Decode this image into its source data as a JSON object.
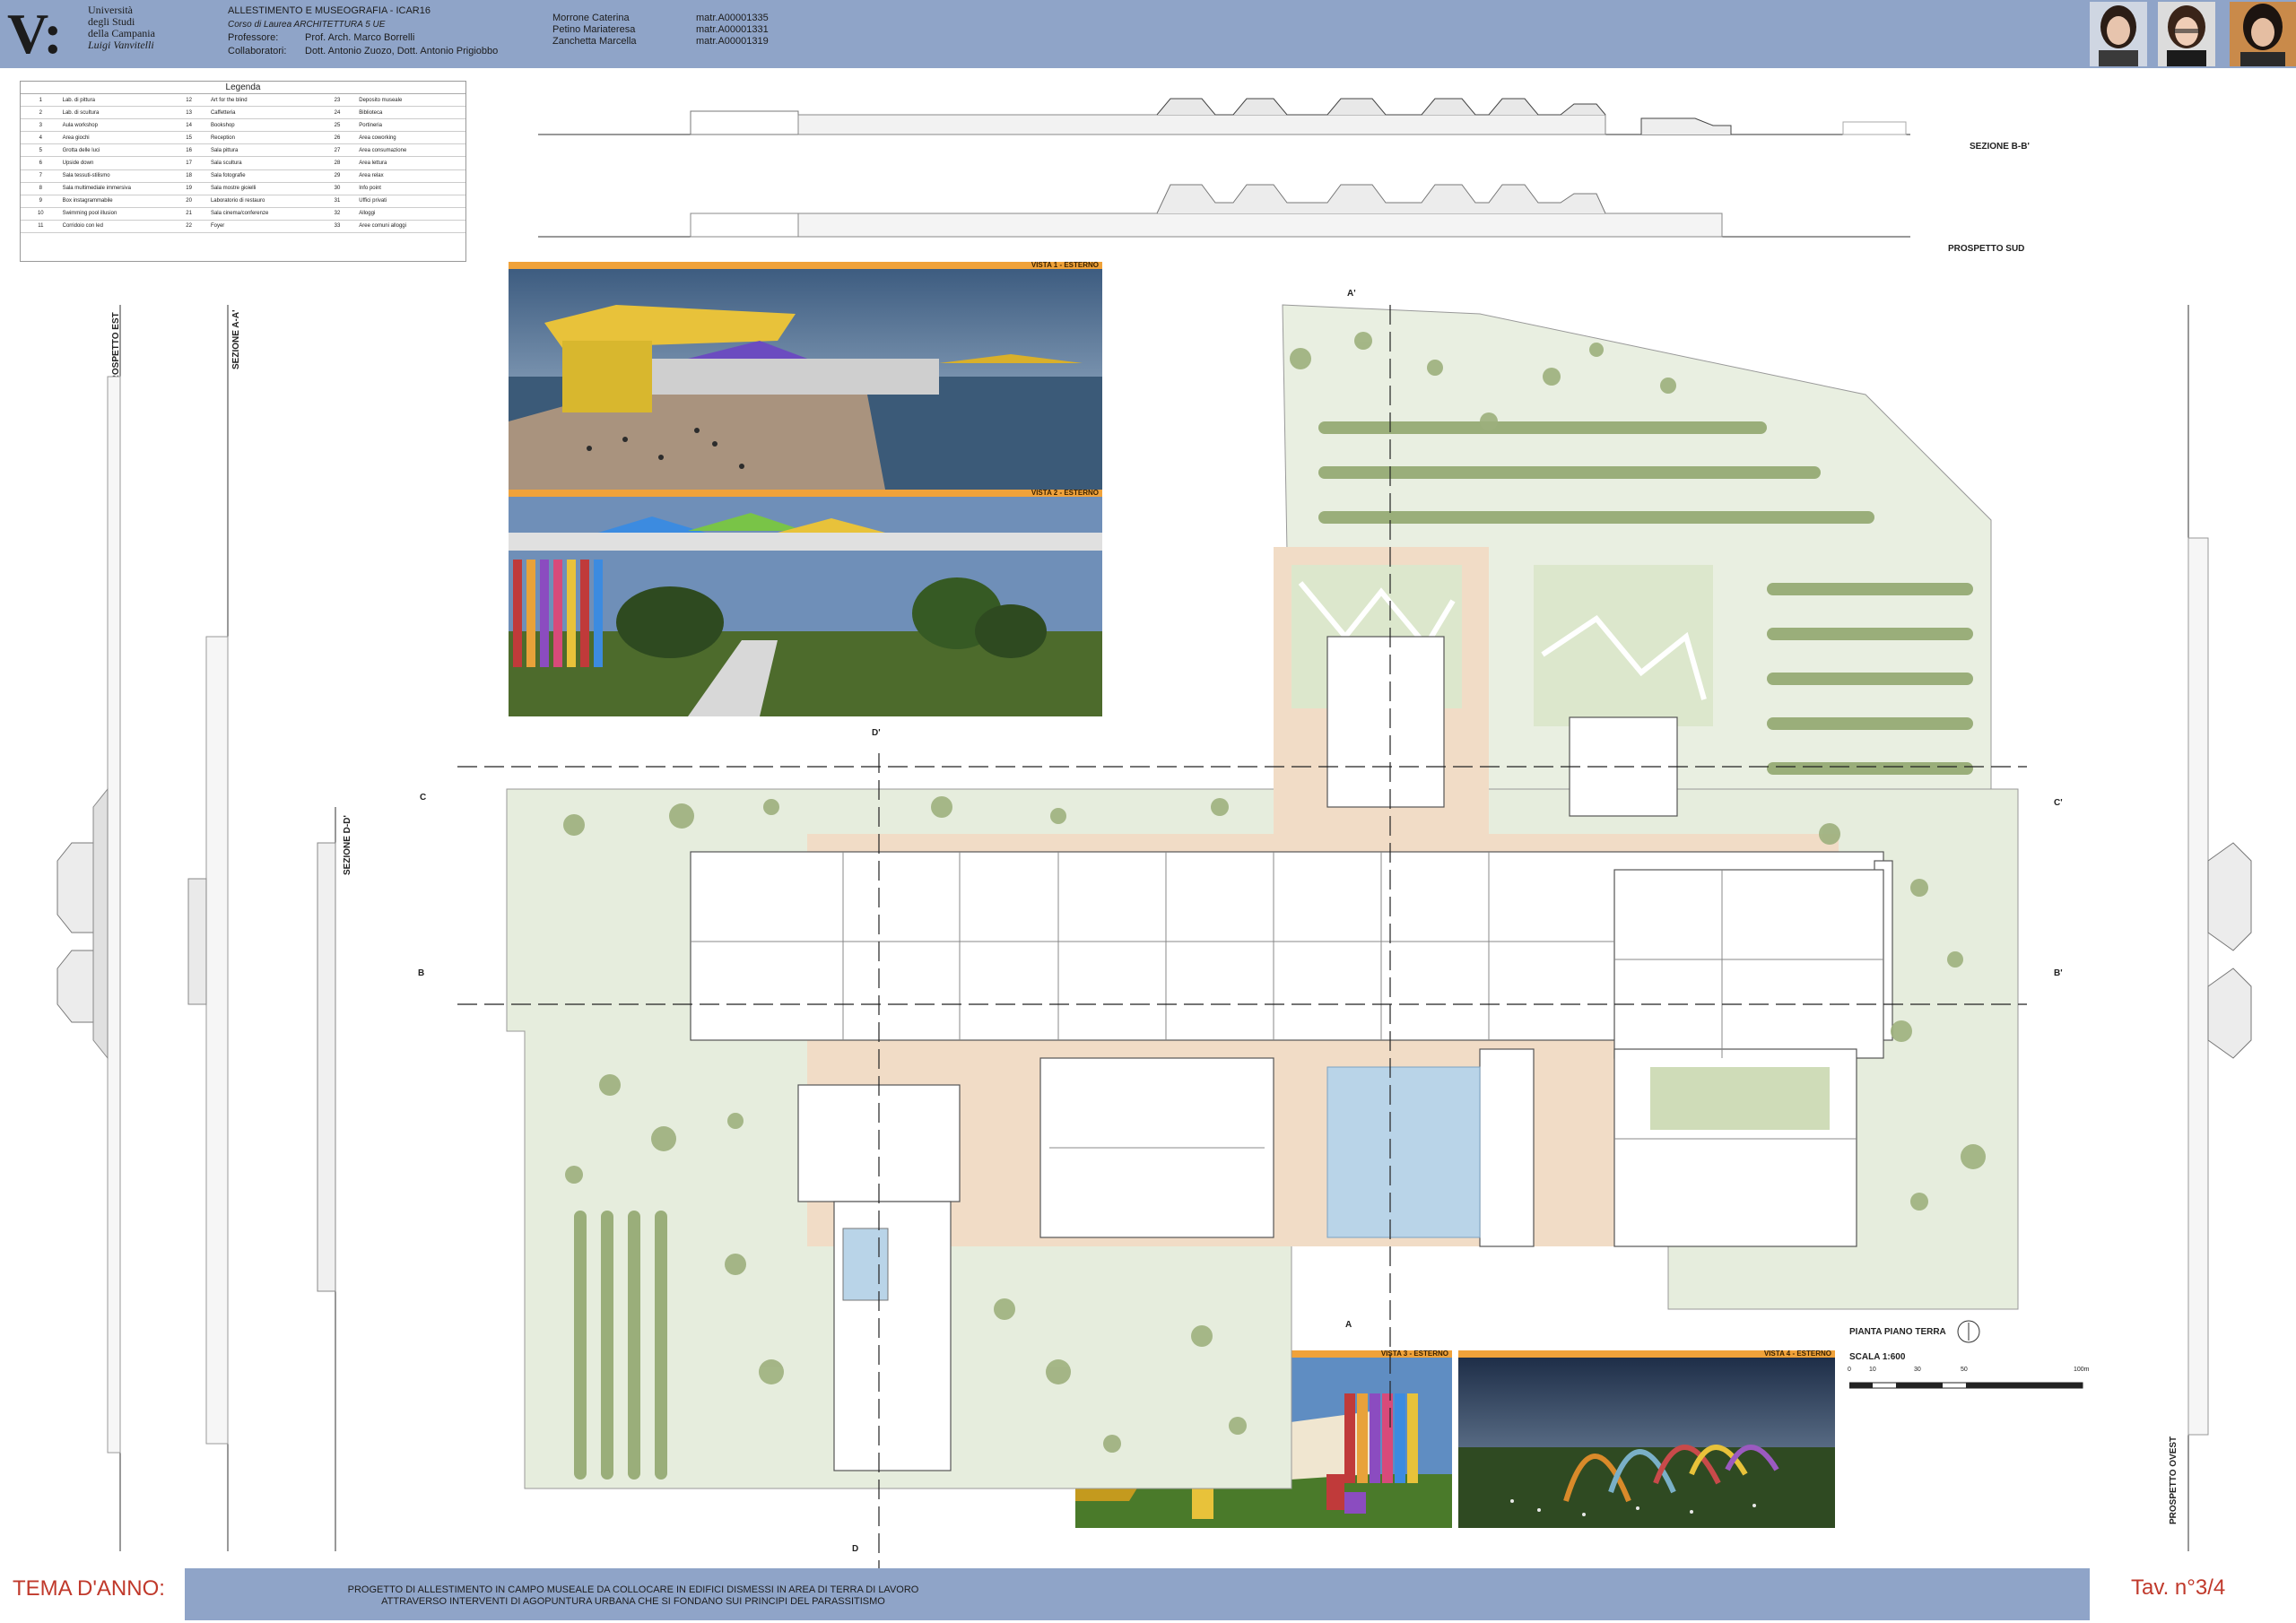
{
  "header": {
    "university": [
      "Università",
      "degli Studi",
      "della Campania",
      "Luigi Vanvitelli"
    ],
    "course_title": "ALLESTIMENTO E MUSEOGRAFIA - ICAR16",
    "course_subtitle": "Corso di Laurea ARCHITETTURA 5 UE",
    "professor_label": "Professore:",
    "professor": "Prof. Arch. Marco Borrelli",
    "collaborators_label": "Collaboratori:",
    "collaborators": "Dott. Antonio Zuozo, Dott. Antonio Prigiobbo",
    "students": [
      {
        "name": "Morrone Caterina",
        "matr": "matr.A00001335"
      },
      {
        "name": "Petino Mariateresa",
        "matr": "matr.A00001331"
      },
      {
        "name": "Zanchetta Marcella",
        "matr": "matr.A00001319"
      }
    ]
  },
  "legend": {
    "title": "Legenda",
    "rows": [
      [
        "1",
        "Lab. di pittura",
        "12",
        "Art for the blind",
        "23",
        "Deposito museale"
      ],
      [
        "2",
        "Lab. di scultura",
        "13",
        "Caffetteria",
        "24",
        "Biblioteca"
      ],
      [
        "3",
        "Aula workshop",
        "14",
        "Bookshop",
        "25",
        "Portineria"
      ],
      [
        "4",
        "Area giochi",
        "15",
        "Reception",
        "26",
        "Area coworking"
      ],
      [
        "5",
        "Grotta delle luci",
        "16",
        "Sala pittura",
        "27",
        "Area consumazione"
      ],
      [
        "6",
        "Upside down",
        "17",
        "Sala scultura",
        "28",
        "Area lettura"
      ],
      [
        "7",
        "Sala tessuti-stilismo",
        "18",
        "Sala fotografie",
        "29",
        "Area relax"
      ],
      [
        "8",
        "Sala multimediale immersiva",
        "19",
        "Sala mostre gioielli",
        "30",
        "Info point"
      ],
      [
        "9",
        "Box instagrammabile",
        "20",
        "Laboratorio di restauro",
        "31",
        "Uffici privati"
      ],
      [
        "10",
        "Swimming pool illusion",
        "21",
        "Sala cinema/conferenze",
        "32",
        "Alloggi"
      ],
      [
        "11",
        "Corridoio con led",
        "22",
        "Foyer",
        "33",
        "Aree comuni alloggi"
      ]
    ]
  },
  "labels": {
    "sezione_bb": "SEZIONE B-B'",
    "prospetto_sud": "PROSPETTO SUD",
    "prospetto_est": "PROSPETTO EST",
    "sezione_aa": "SEZIONE A-A'",
    "sezione_dd": "SEZIONE D-D'",
    "prospetto_ovest": "PROSPETTO OVEST",
    "vista1": "VISTA 1 - ESTERNO",
    "vista2": "VISTA 2 - ESTERNO",
    "vista3": "VISTA 3 - ESTERNO",
    "vista4": "VISTA 4 - ESTERNO",
    "pianta": "PIANTA PIANO TERRA",
    "scala": "SCALA 1:600",
    "scale_ticks": [
      "0",
      "10",
      "30",
      "50",
      "100m"
    ],
    "cut_a": "A",
    "cut_a2": "A'",
    "cut_b": "B",
    "cut_b2": "B'",
    "cut_c": "C",
    "cut_c2": "C'",
    "cut_d": "D",
    "cut_d2": "D'"
  },
  "footer": {
    "tema": "TEMA D'ANNO:",
    "project_line1": "PROGETTO DI ALLESTIMENTO IN CAMPO MUSEALE DA COLLOCARE IN EDIFICI DISMESSI IN AREA DI TERRA DI LAVORO",
    "project_line2": "ATTRAVERSO INTERVENTI DI AGOPUNTURA URBANA CHE SI FONDANO SUI PRINCIPI DEL PARASSITISMO",
    "tav": "Tav. n°3/4"
  },
  "colors": {
    "header_band": "#8fa4c8",
    "accent_orange": "#f0a23a",
    "tema_red": "#c0392b",
    "grass": "#dfe8d2",
    "path": "#f1dcc6",
    "pool": "#b9d4e8"
  }
}
